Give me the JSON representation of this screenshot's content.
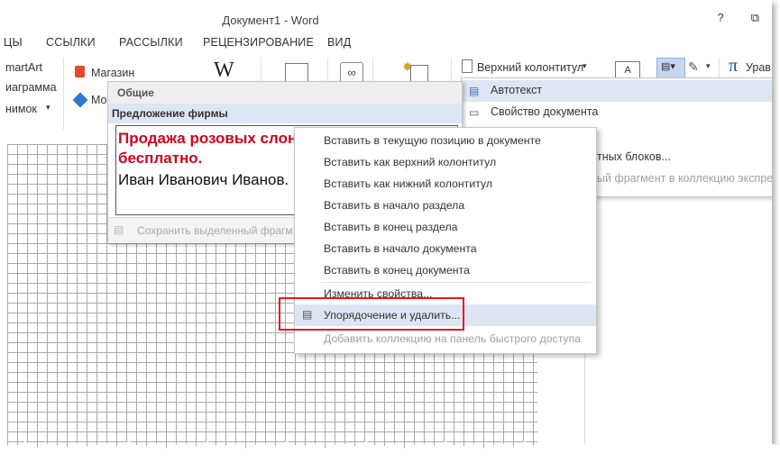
{
  "window": {
    "title": "Документ1 - Word",
    "help": "?",
    "restore": "⧉"
  },
  "tabs": [
    "ЦЫ",
    "ССЫЛКИ",
    "РАССЫЛКИ",
    "РЕЦЕНЗИРОВАНИЕ",
    "ВИД"
  ],
  "ribbon": {
    "smartart": "martArt",
    "diagram": "иаграмма",
    "snapshot": "нимок",
    "store": "Магазин",
    "myapps": "Мо",
    "wiki": "W",
    "header": "Верхний колонтитул",
    "formula": "Урав",
    "pi": "π"
  },
  "autotext_panel": {
    "category": "Общие",
    "entry_title": "Предложение фирмы",
    "preview_line1": "Продажа розовых слоно",
    "preview_line2": "бесплатно.",
    "preview_line3": "Иван Иванович Иванов.",
    "save_selection": "Сохранить выделенный фрагм"
  },
  "quickparts_menu": {
    "items": [
      "Автотекст",
      "Свойство документа"
    ],
    "partial1": "тных блоков...",
    "partial2": "ый фрагмент в коллекцию экспресс"
  },
  "context_menu": {
    "items": [
      "Вставить в текущую позицию в документе",
      "Вставить как верхний колонтитул",
      "Вставить как нижний колонтитул",
      "Вставить в начало раздела",
      "Вставить в конец раздела",
      "Вставить в начало документа",
      "Вставить в конец документа",
      "Изменить свойства...",
      "Упорядочение и удалить...",
      "Добавить коллекцию на панель быстрого доступа"
    ]
  },
  "colors": {
    "accent_red": "#d0021b",
    "highlight": "#dde5f3",
    "callout": "#e8181a"
  }
}
